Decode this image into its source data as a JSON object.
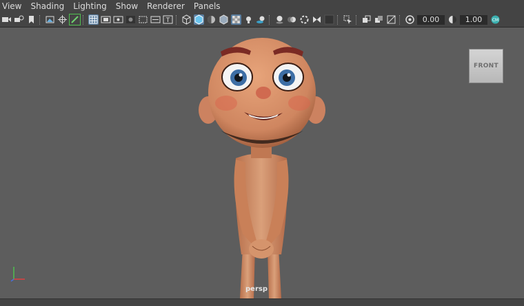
{
  "menus": [
    "View",
    "Shading",
    "Lighting",
    "Show",
    "Renderer",
    "Panels"
  ],
  "toolbar": {
    "exposure_value": "0.00",
    "gamma_value": "1.00",
    "icons": [
      "camera-select-icon",
      "camera-attributes-icon",
      "bookmark-icon",
      "image-plane-icon",
      "2d-pan-zoom-icon",
      "grease-pencil-icon",
      "grid-icon",
      "film-gate-icon",
      "resolution-gate-icon",
      "gate-mask-icon",
      "field-chart-icon",
      "safe-action-icon",
      "safe-title-icon",
      "wireframe-icon",
      "smooth-shade-icon",
      "wireframe-on-shaded-icon",
      "default-material-icon",
      "xray-icon",
      "use-lights-icon",
      "shadows-icon",
      "screen-space-ao-icon",
      "motion-blur-icon",
      "anti-aliasing-icon",
      "depth-of-field-icon",
      "isolate-select-icon",
      "xray-joints-icon",
      "xray-active-icon",
      "backface-culling-icon",
      "exposure-icon",
      "gamma-icon",
      "color-management-icon"
    ]
  },
  "viewport": {
    "camera_label": "persp",
    "view_cube_label": "FRONT"
  },
  "colors": {
    "viewport_bg": "#5d5d5d",
    "ui_bg": "#444444",
    "skin": "#d28a62",
    "eyebrow": "#7a2a24",
    "active_icon": "#5a7ea0"
  }
}
